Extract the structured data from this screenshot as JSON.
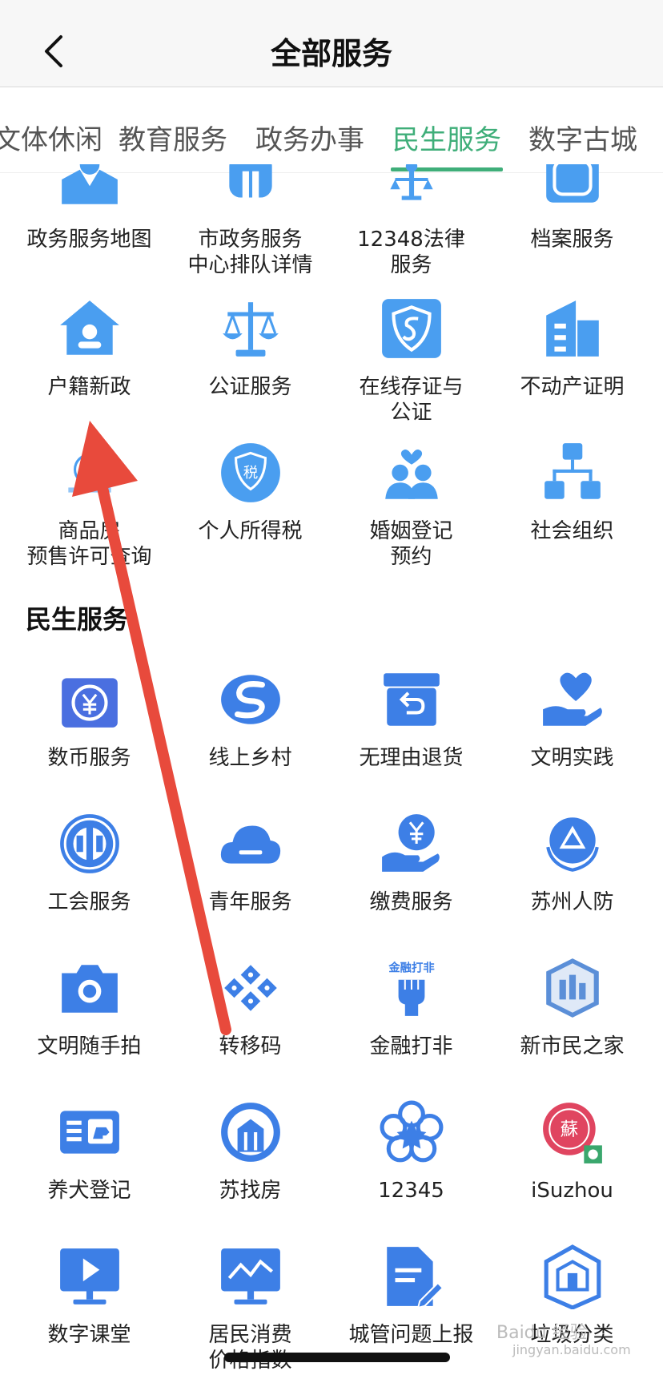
{
  "header": {
    "title": "全部服务"
  },
  "tabs": [
    {
      "label": "文体休闲",
      "active": false
    },
    {
      "label": "教育服务",
      "active": false
    },
    {
      "label": "政务办事",
      "active": false
    },
    {
      "label": "民生服务",
      "active": true
    },
    {
      "label": "数字古城",
      "active": false
    }
  ],
  "accent_color": "#3fae79",
  "icon_color": "#4a9ef0",
  "gov_items": [
    {
      "label": "政务服务地图",
      "icon": "map-person-icon"
    },
    {
      "label": "市政务服务\n中心排队详情",
      "icon": "queue-icon"
    },
    {
      "label": "12348法律\n服务",
      "icon": "law-scale-person-icon"
    },
    {
      "label": "档案服务",
      "icon": "archive-icon"
    },
    {
      "label": "户籍新政",
      "icon": "house-person-icon"
    },
    {
      "label": "公证服务",
      "icon": "scale-icon"
    },
    {
      "label": "在线存证与\n公证",
      "icon": "shield-s-icon"
    },
    {
      "label": "不动产证明",
      "icon": "building-icon"
    },
    {
      "label": "商品房\n预售许可查询",
      "icon": "estate-logo-icon"
    },
    {
      "label": "个人所得税",
      "icon": "tax-shield-icon"
    },
    {
      "label": "婚姻登记\n预约",
      "icon": "couple-heart-icon"
    },
    {
      "label": "社会组织",
      "icon": "org-chart-icon"
    }
  ],
  "section": {
    "title": "民生服务"
  },
  "life_items": [
    {
      "label": "数币服务",
      "icon": "yuan-wallet-icon"
    },
    {
      "label": "线上乡村",
      "icon": "s-swirl-icon"
    },
    {
      "label": "无理由退货",
      "icon": "return-box-icon"
    },
    {
      "label": "文明实践",
      "icon": "heart-hand-icon"
    },
    {
      "label": "工会服务",
      "icon": "union-emblem-icon"
    },
    {
      "label": "青年服务",
      "icon": "cloud-icon"
    },
    {
      "label": "缴费服务",
      "icon": "yuan-hand-icon"
    },
    {
      "label": "苏州人防",
      "icon": "civil-defense-icon"
    },
    {
      "label": "文明随手拍",
      "icon": "camera-icon"
    },
    {
      "label": "转移码",
      "icon": "pattern-code-icon"
    },
    {
      "label": "金融打非",
      "icon": "fist-icon"
    },
    {
      "label": "新市民之家",
      "icon": "new-citizen-icon"
    },
    {
      "label": "养犬登记",
      "icon": "dog-card-icon"
    },
    {
      "label": "苏找房",
      "icon": "house-search-icon"
    },
    {
      "label": "12345",
      "icon": "star-flower-icon"
    },
    {
      "label": "iSuzhou",
      "icon": "isuzhou-logo-icon"
    },
    {
      "label": "数字课堂",
      "icon": "monitor-play-icon"
    },
    {
      "label": "居民消费\n价格指数",
      "icon": "monitor-chart-icon"
    },
    {
      "label": "城管问题上报",
      "icon": "report-doc-icon"
    },
    {
      "label": "垃圾分类",
      "icon": "trash-house-icon"
    }
  ],
  "overlay": {
    "annotation": "red-arrow"
  },
  "watermark": "Baidu 经验",
  "watermark_url": "jingyan.baidu.com"
}
